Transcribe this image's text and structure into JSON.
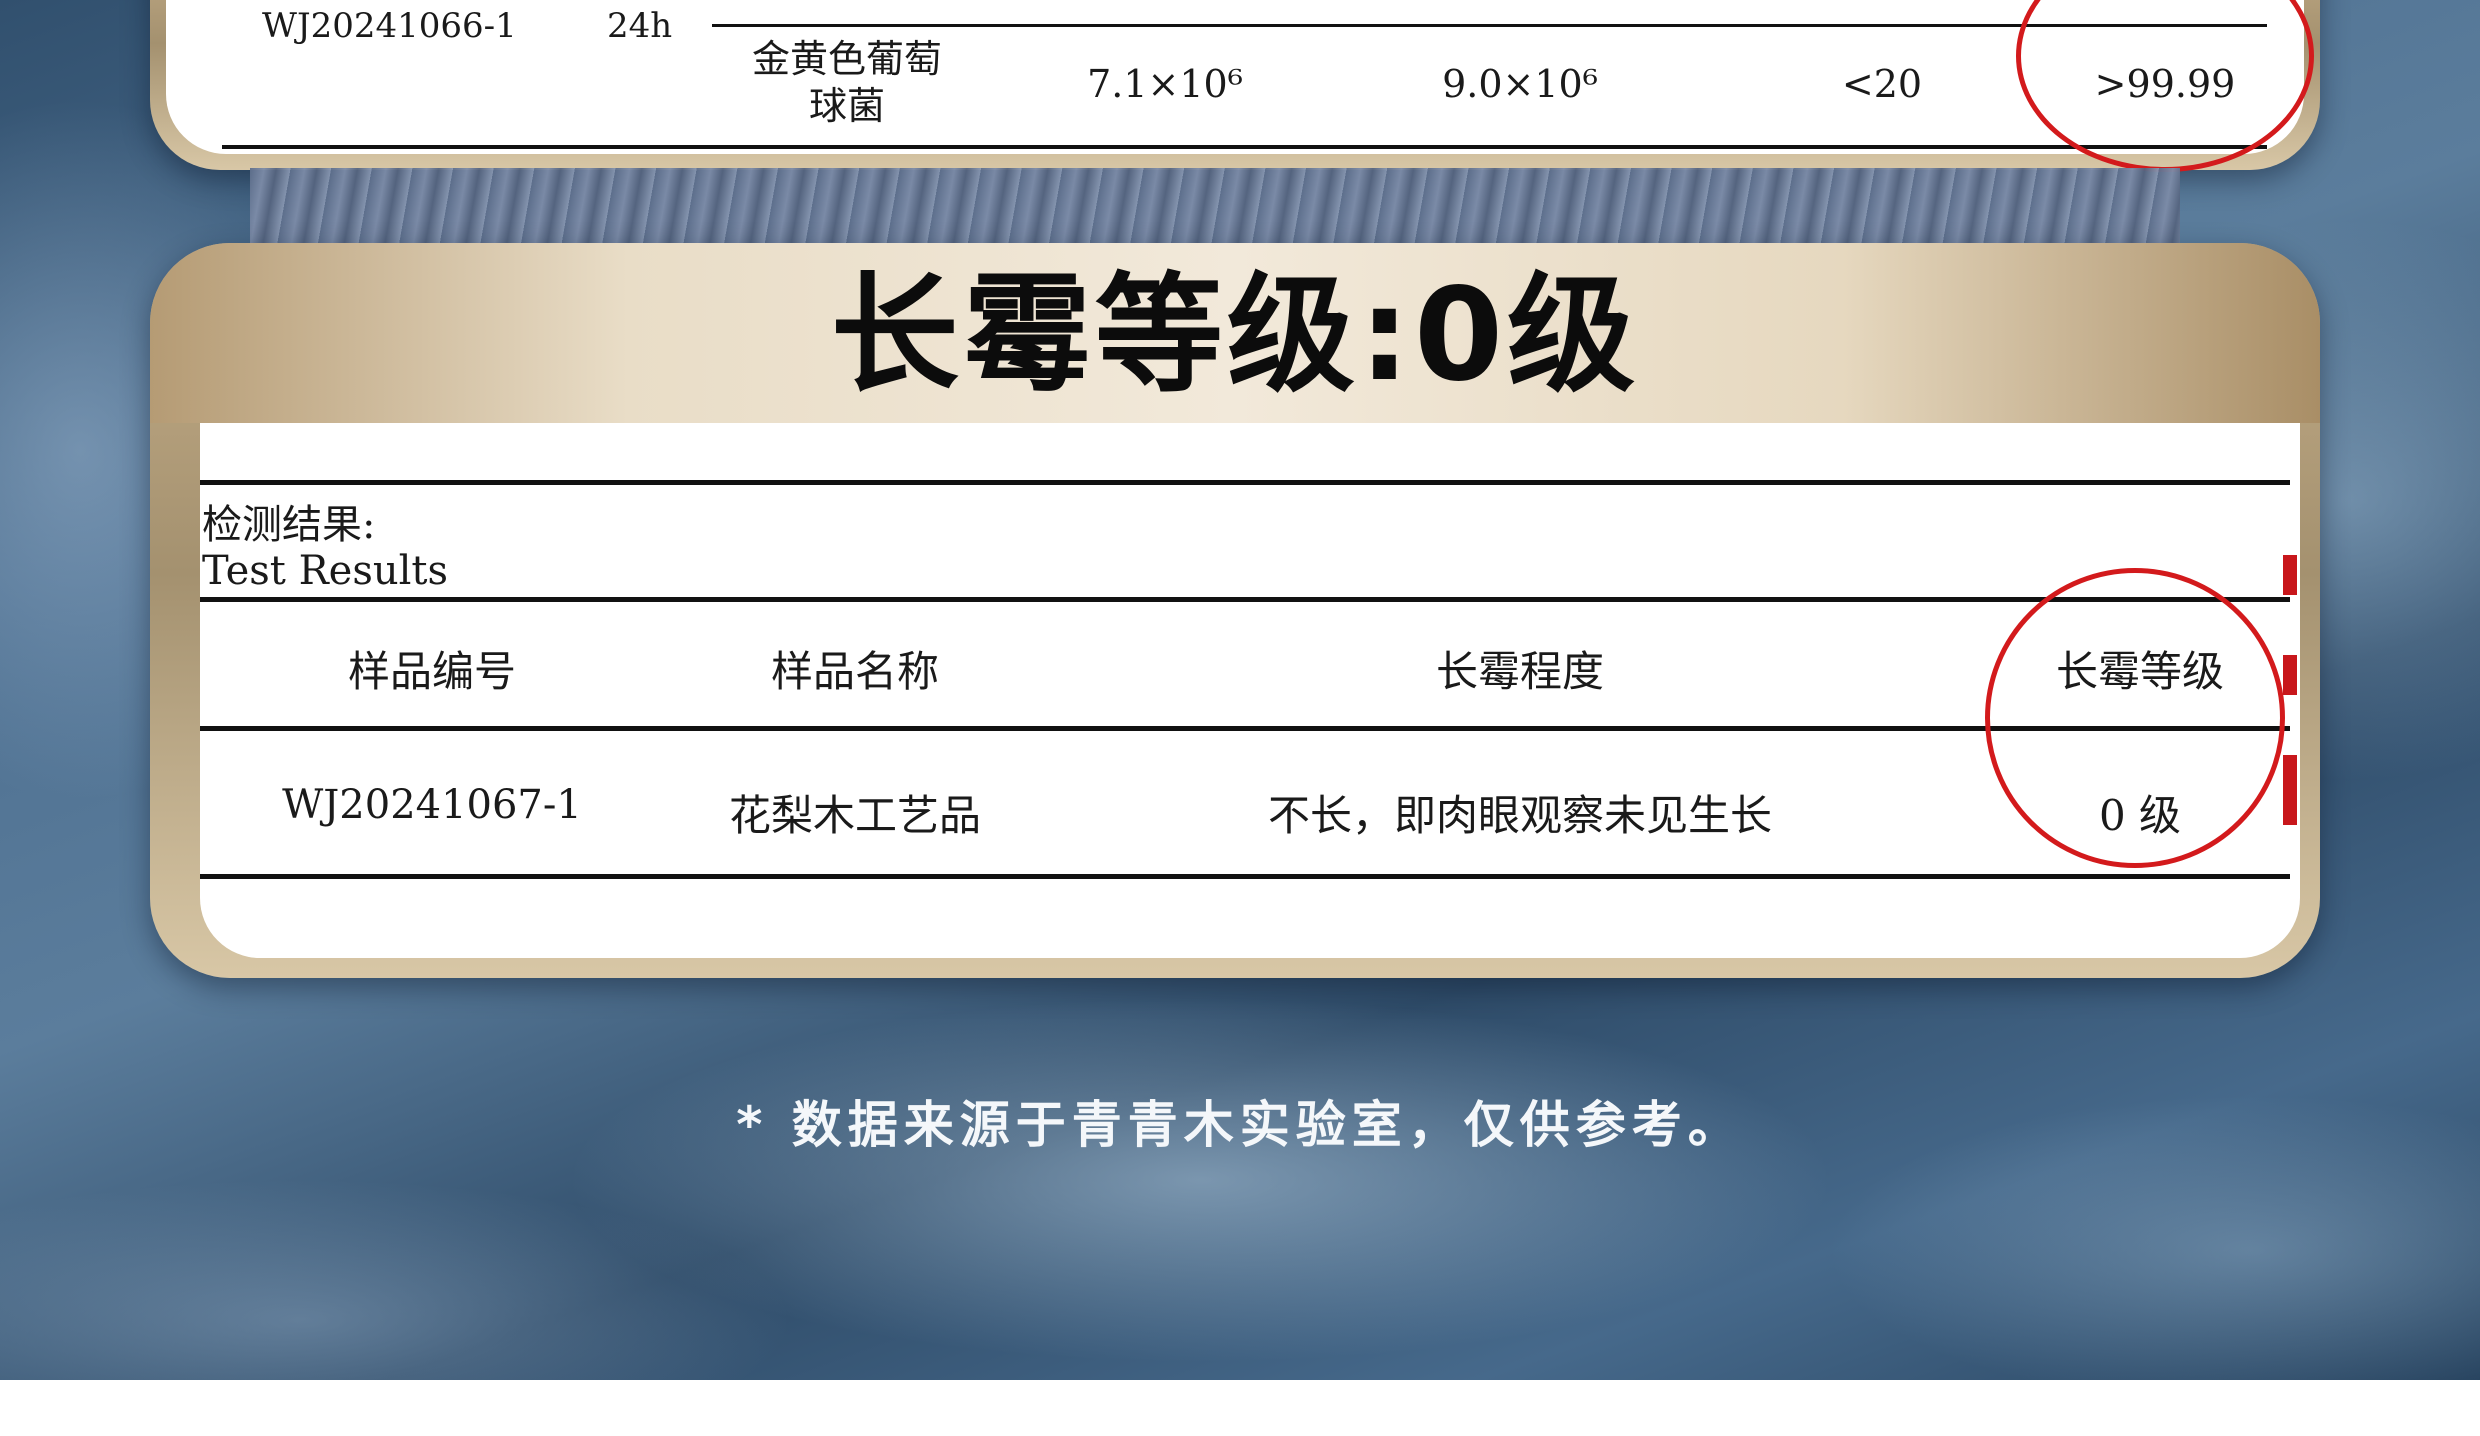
{
  "top_table": {
    "sample_id": "WJ20241066-1",
    "duration": "24h",
    "organism": "金黄色葡萄\n球菌",
    "col1": "7.1×10⁶",
    "col2": "9.0×10⁶",
    "col3": "<20",
    "col4": ">99.99"
  },
  "mold_card": {
    "title": "长霉等级:0级",
    "results_label_cn": "检测结果:",
    "results_label_en": "Test Results",
    "headers": [
      "样品编号",
      "样品名称",
      "长霉程度",
      "长霉等级"
    ],
    "row": [
      "WJ20241067-1",
      "花梨木工艺品",
      "不长，即肉眼观察未见生长",
      "0 级"
    ]
  },
  "footnote": "* 数据来源于青青木实验室，仅供参考。",
  "colors": {
    "accent_red": "#d31a1c",
    "gold_frame": "#b59b74",
    "background_blue": "#4d6f90"
  }
}
